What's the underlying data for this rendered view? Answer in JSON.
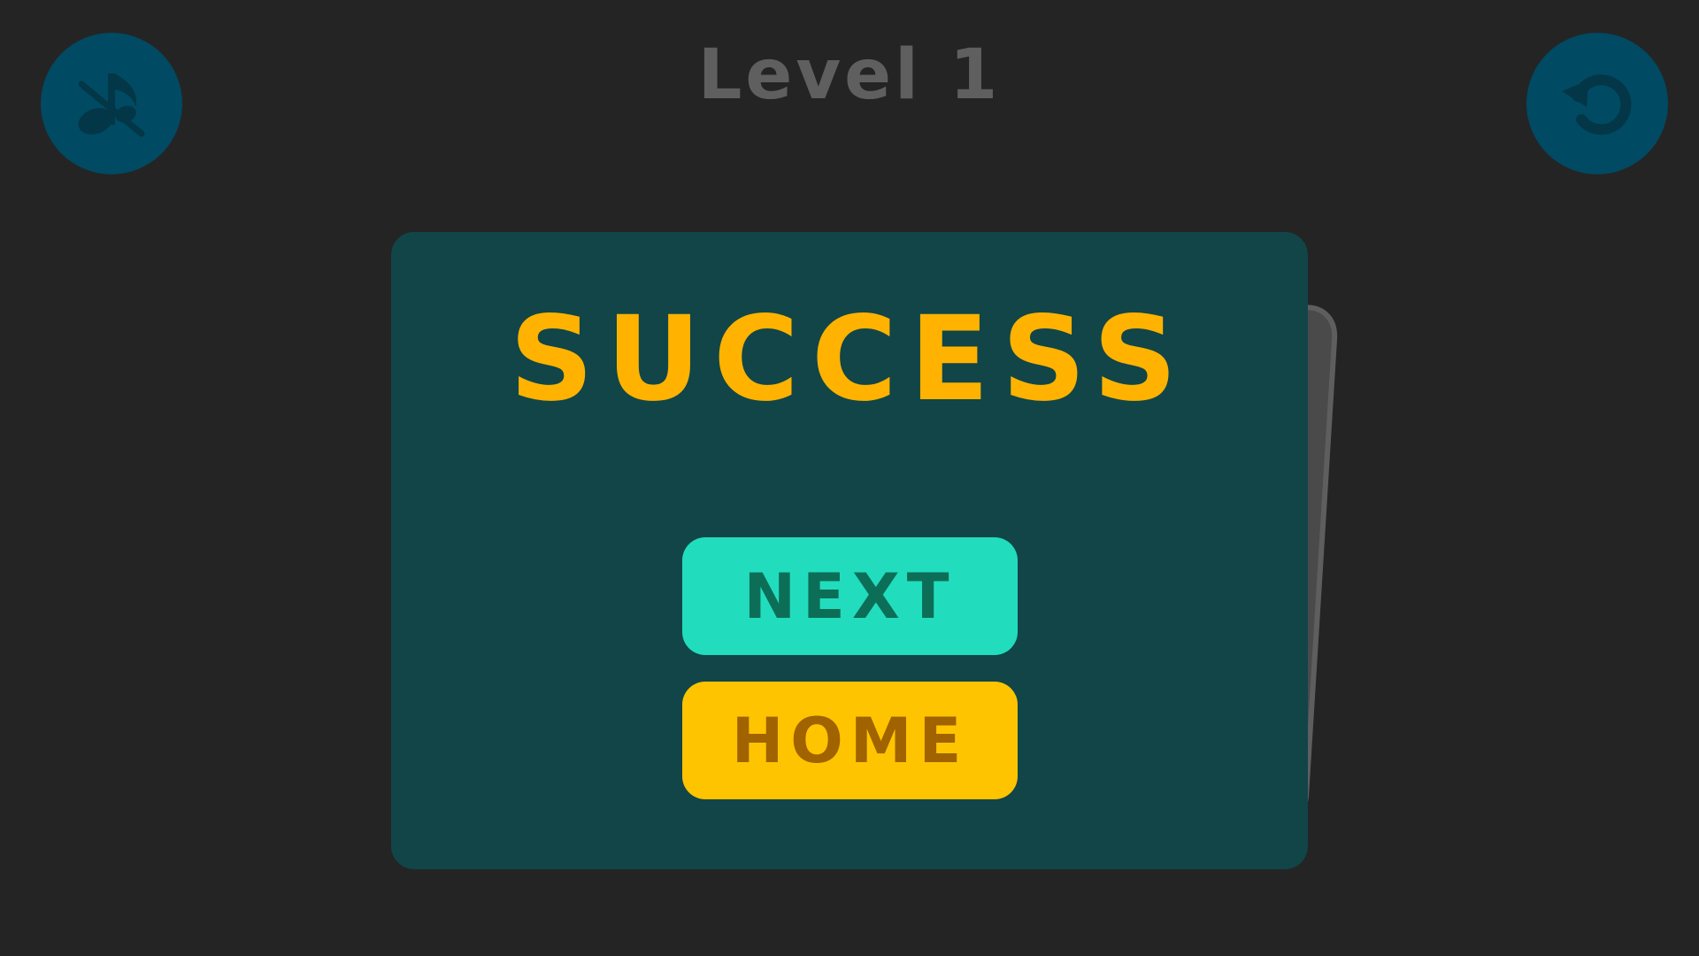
{
  "header": {
    "level_label": "Level 1"
  },
  "controls": {
    "music_icon": "music-off-icon",
    "reset_icon": "restart-icon"
  },
  "dialog": {
    "title": "SUCCESS",
    "next_label": "NEXT",
    "home_label": "HOME"
  },
  "colors": {
    "background": "#242424",
    "panel": "#114548",
    "title": "#ffb300",
    "next_button": "#21ddbd",
    "home_button": "#ffc400",
    "round_button": "#004a63"
  }
}
